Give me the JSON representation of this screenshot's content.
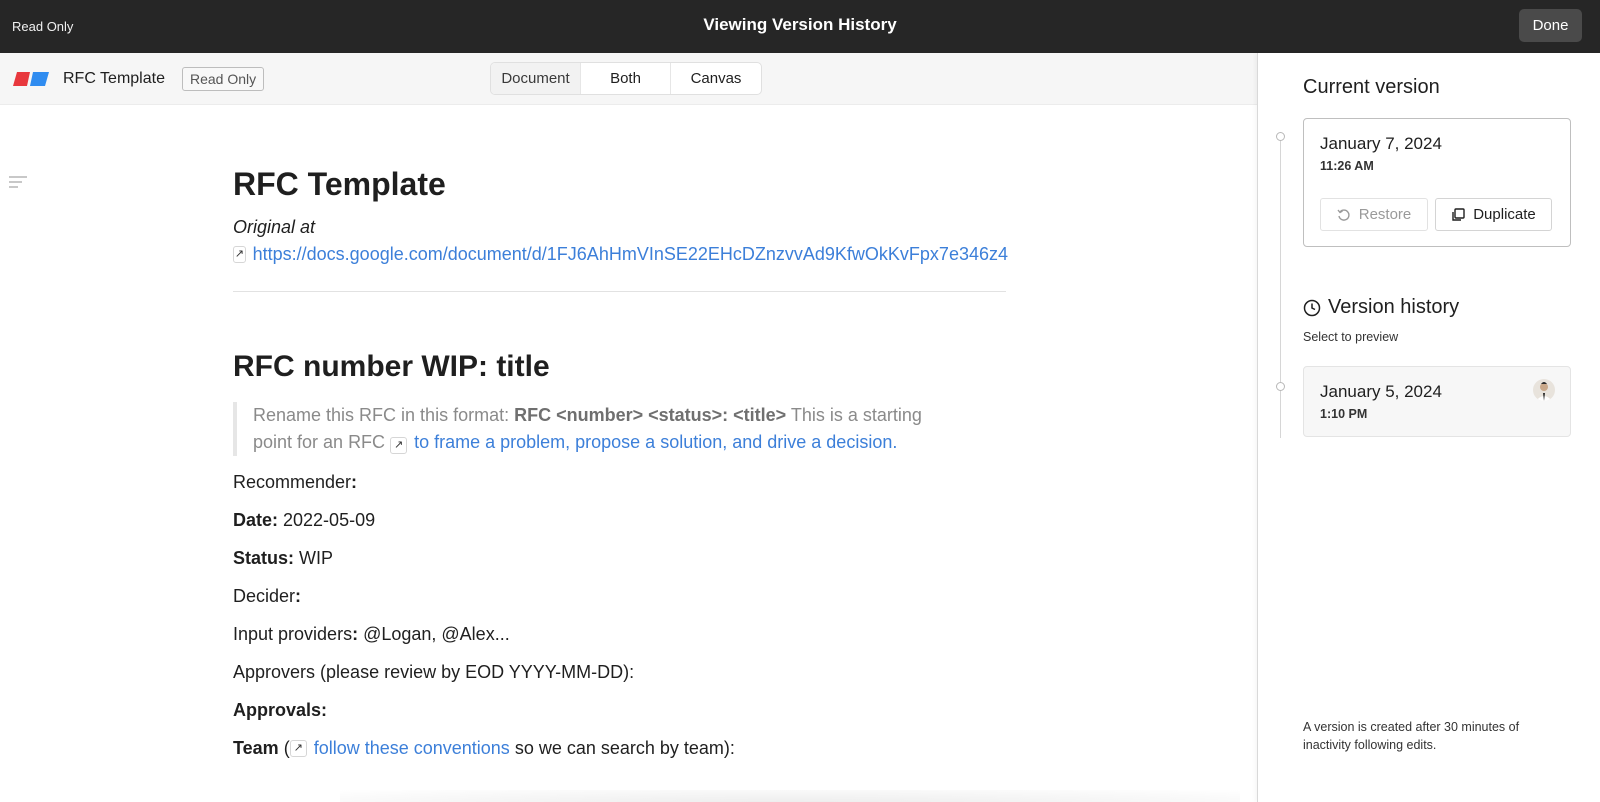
{
  "topbar": {
    "read_only": "Read Only",
    "title": "Viewing Version History",
    "done_label": "Done"
  },
  "header": {
    "doc_name": "RFC Template",
    "badge": "Read Only",
    "view_tabs": [
      {
        "label": "Document",
        "active": true
      },
      {
        "label": "Both",
        "active": false
      },
      {
        "label": "Canvas",
        "active": false
      }
    ],
    "logo_colors": [
      "#e8383d",
      "#2f8cf0"
    ]
  },
  "document": {
    "title": "RFC Template",
    "original_at": "Original at",
    "original_link": "https://docs.google.com/document/d/1FJ6AhHmVInSE22EHcDZnzvvAd9KfwOkKvFpx7e346z4",
    "heading2": "RFC number WIP: title",
    "quote": {
      "prefix": "Rename this RFC in this format: ",
      "format_bold": "RFC <number> <status>: <title>",
      "middle": " This is a starting point for an RFC ",
      "link": "to frame a problem, propose a solution, and drive a decision."
    },
    "fields": {
      "recommender_label": "Recommender",
      "colon": ":",
      "date_label": "Date:",
      "date_value": " 2022-05-09",
      "status_label": "Status:",
      "status_value": " WIP",
      "decider_label": "Decider",
      "input_label": "Input providers",
      "input_value": " @Logan, @Alex...",
      "approvers": "Approvers (please review by EOD YYYY-MM-DD):",
      "approvals_label": "Approvals:",
      "team_label": "Team",
      "team_open": " (",
      "team_link": "follow these conventions",
      "team_rest": " so we can search by team):"
    },
    "link_color": "#3c7fd9"
  },
  "panel": {
    "current_heading": "Current version",
    "current": {
      "date": "January 7, 2024",
      "time": "11:26 AM",
      "restore_label": "Restore",
      "duplicate_label": "Duplicate"
    },
    "history_heading": "Version history",
    "history_sub": "Select to preview",
    "history_items": [
      {
        "date": "January 5, 2024",
        "time": "1:10 PM"
      }
    ],
    "note": "A version is created after 30 minutes of inactivity following edits."
  }
}
